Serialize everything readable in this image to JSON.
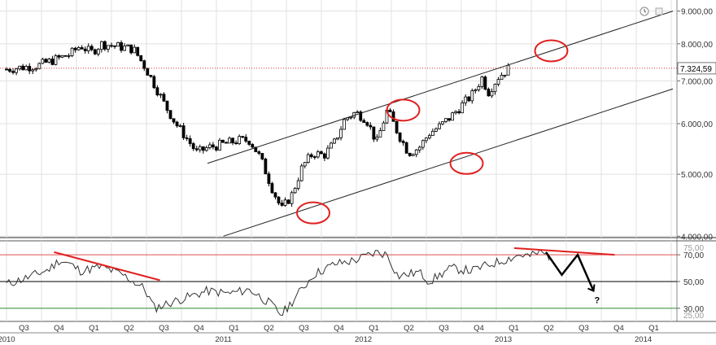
{
  "chart_data": {
    "type": "candlestick+line",
    "price_panel": {
      "y_scale": "log",
      "y_ticks": [
        "4.000,00",
        "5.000,00",
        "6.000,00",
        "7.000,00",
        "8.000,00",
        "9.000,00"
      ],
      "y_tick_values": [
        4000,
        5000,
        6000,
        7000,
        8000,
        9000
      ],
      "last_price_label": "7.324,59",
      "last_price": 7324.59,
      "close_series": [
        {
          "t": 0,
          "v": 7300
        },
        {
          "t": 3,
          "v": 7350
        },
        {
          "t": 6,
          "v": 7400
        },
        {
          "t": 9,
          "v": 7550
        },
        {
          "t": 12,
          "v": 7700
        },
        {
          "t": 14,
          "v": 7950
        },
        {
          "t": 16,
          "v": 7750
        },
        {
          "t": 18,
          "v": 8000
        },
        {
          "t": 20,
          "v": 7950
        },
        {
          "t": 22,
          "v": 7900
        },
        {
          "t": 24,
          "v": 7850
        },
        {
          "t": 26,
          "v": 7400
        },
        {
          "t": 28,
          "v": 6900
        },
        {
          "t": 30,
          "v": 6400
        },
        {
          "t": 32,
          "v": 6000
        },
        {
          "t": 34,
          "v": 5700
        },
        {
          "t": 36,
          "v": 5400
        },
        {
          "t": 38,
          "v": 5500
        },
        {
          "t": 40,
          "v": 5550
        },
        {
          "t": 42,
          "v": 5600
        },
        {
          "t": 44,
          "v": 5650
        },
        {
          "t": 46,
          "v": 5650
        },
        {
          "t": 48,
          "v": 5300
        },
        {
          "t": 50,
          "v": 4800
        },
        {
          "t": 52,
          "v": 4400
        },
        {
          "t": 54,
          "v": 4650
        },
        {
          "t": 56,
          "v": 5150
        },
        {
          "t": 58,
          "v": 5400
        },
        {
          "t": 60,
          "v": 5350
        },
        {
          "t": 62,
          "v": 5600
        },
        {
          "t": 64,
          "v": 6100
        },
        {
          "t": 66,
          "v": 6250
        },
        {
          "t": 68,
          "v": 6100
        },
        {
          "t": 70,
          "v": 5600
        },
        {
          "t": 72,
          "v": 6300
        },
        {
          "t": 74,
          "v": 5800
        },
        {
          "t": 76,
          "v": 5400
        },
        {
          "t": 78,
          "v": 5500
        },
        {
          "t": 80,
          "v": 5800
        },
        {
          "t": 82,
          "v": 5950
        },
        {
          "t": 84,
          "v": 6150
        },
        {
          "t": 86,
          "v": 6400
        },
        {
          "t": 88,
          "v": 6650
        },
        {
          "t": 90,
          "v": 7100
        },
        {
          "t": 91,
          "v": 6700
        },
        {
          "t": 93,
          "v": 7100
        },
        {
          "t": 95,
          "v": 7324.59
        }
      ],
      "channel_lines": [
        {
          "name": "upper",
          "from": {
            "t": 38,
            "v": 5200
          },
          "to": {
            "t": 126,
            "v": 9000
          }
        },
        {
          "name": "lower",
          "from": {
            "t": 41,
            "v": 4000
          },
          "to": {
            "t": 126,
            "v": 6800
          }
        }
      ],
      "circled_points": [
        {
          "t": 58,
          "v": 4350
        },
        {
          "t": 75,
          "v": 6300
        },
        {
          "t": 87,
          "v": 5200
        },
        {
          "t": 103,
          "v": 7800
        }
      ]
    },
    "oscillator_panel": {
      "y_ticks": [
        "30,00",
        "50,00",
        "70,00"
      ],
      "y_tick_values": [
        30,
        50,
        70
      ],
      "top_tick_partial": "75,00",
      "bottom_tick_partial": "25,00",
      "reference_lines": [
        {
          "value": 70,
          "color": "#e05050"
        },
        {
          "value": 50,
          "color": "#000000"
        },
        {
          "value": 30,
          "color": "#2a8a2a"
        }
      ],
      "series": [
        {
          "t": 0,
          "v": 48
        },
        {
          "t": 4,
          "v": 53
        },
        {
          "t": 8,
          "v": 59
        },
        {
          "t": 10,
          "v": 66
        },
        {
          "t": 12,
          "v": 63
        },
        {
          "t": 14,
          "v": 58
        },
        {
          "t": 18,
          "v": 61
        },
        {
          "t": 22,
          "v": 55
        },
        {
          "t": 26,
          "v": 45
        },
        {
          "t": 28,
          "v": 30
        },
        {
          "t": 30,
          "v": 33
        },
        {
          "t": 34,
          "v": 38
        },
        {
          "t": 38,
          "v": 43
        },
        {
          "t": 42,
          "v": 41
        },
        {
          "t": 46,
          "v": 44
        },
        {
          "t": 50,
          "v": 33
        },
        {
          "t": 52,
          "v": 25
        },
        {
          "t": 55,
          "v": 40
        },
        {
          "t": 58,
          "v": 55
        },
        {
          "t": 62,
          "v": 63
        },
        {
          "t": 66,
          "v": 66
        },
        {
          "t": 70,
          "v": 72
        },
        {
          "t": 72,
          "v": 70
        },
        {
          "t": 74,
          "v": 54
        },
        {
          "t": 78,
          "v": 57
        },
        {
          "t": 80,
          "v": 50
        },
        {
          "t": 84,
          "v": 60
        },
        {
          "t": 88,
          "v": 58
        },
        {
          "t": 90,
          "v": 61
        },
        {
          "t": 94,
          "v": 66
        },
        {
          "t": 97,
          "v": 70
        },
        {
          "t": 99,
          "v": 69
        },
        {
          "t": 101,
          "v": 72
        },
        {
          "t": 103,
          "v": 68
        }
      ],
      "annotations": {
        "divergence_lines": [
          {
            "from": {
              "t": 9,
              "v": 72
            },
            "to": {
              "t": 29,
              "v": 51
            }
          },
          {
            "from": {
              "t": 96,
              "v": 75
            },
            "to": {
              "t": 115,
              "v": 70
            }
          }
        ],
        "projected_path": [
          {
            "t": 102,
            "v": 72
          },
          {
            "t": 105,
            "v": 55
          },
          {
            "t": 108,
            "v": 70
          },
          {
            "t": 111,
            "v": 43
          }
        ],
        "question_mark": "?"
      }
    },
    "x_axis": {
      "quarter_labels": [
        "Q3",
        "Q4",
        "Q1",
        "Q2",
        "Q3",
        "Q4",
        "Q1",
        "Q2",
        "Q3",
        "Q4",
        "Q1",
        "Q2",
        "Q3",
        "Q4",
        "Q1",
        "Q2",
        "Q3",
        "Q4",
        "Q1"
      ],
      "year_labels": [
        "2010",
        "2011",
        "2012",
        "2013",
        "2014"
      ],
      "year_positions_q": [
        0,
        4,
        8,
        12,
        16
      ]
    }
  },
  "toolbar": {
    "top_right_icons": [
      "clock-icon",
      "window-icon"
    ]
  }
}
